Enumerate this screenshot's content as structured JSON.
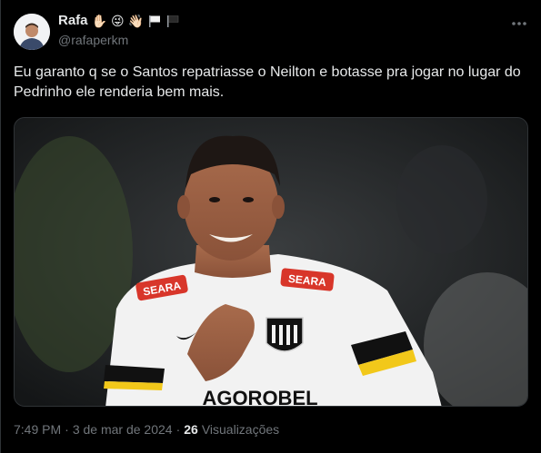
{
  "author": {
    "name": "Rafa",
    "handle": "@rafaperkm",
    "name_emojis": [
      "✋🏻",
      "😜",
      "👋🏻"
    ],
    "avatar_icon": "user-avatar-photo"
  },
  "tweet": {
    "text": "Eu garanto q se o Santos repatriasse o Neilton e botasse pra jogar no lugar do Pedrinho ele renderia bem mais.",
    "media_icon": "soccer-player-photo",
    "jersey_sponsor": "SEARA",
    "jersey_chest": "AGOROBEL"
  },
  "meta": {
    "time": "7:49 PM",
    "separator": "·",
    "date": "3 de mar de 2024",
    "separator2": "·",
    "views_count": "26",
    "views_label": "Visualizações"
  },
  "colors": {
    "background": "#000000",
    "text": "#e7e9ea",
    "secondary": "#71767b",
    "border": "#2f3336"
  }
}
